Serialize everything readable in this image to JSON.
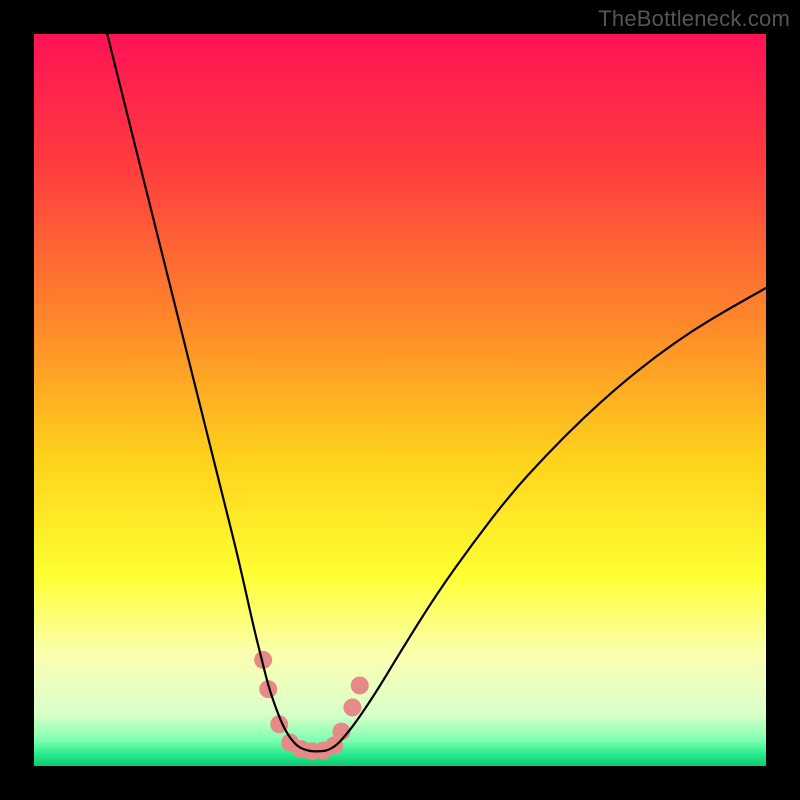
{
  "watermark": "TheBottleneck.com",
  "chart_data": {
    "type": "line",
    "title": "",
    "xlabel": "",
    "ylabel": "",
    "xlim": [
      0,
      100
    ],
    "ylim": [
      0,
      100
    ],
    "grid": false,
    "legend": false,
    "background_gradient_stops": [
      {
        "pos": 0.0,
        "color": "#ff1356"
      },
      {
        "pos": 0.18,
        "color": "#ff3c3e"
      },
      {
        "pos": 0.4,
        "color": "#ff8a2a"
      },
      {
        "pos": 0.58,
        "color": "#ffd21c"
      },
      {
        "pos": 0.74,
        "color": "#ffff33"
      },
      {
        "pos": 0.85,
        "color": "#faffb2"
      },
      {
        "pos": 0.93,
        "color": "#d9ffc9"
      },
      {
        "pos": 0.965,
        "color": "#7dffb0"
      },
      {
        "pos": 0.985,
        "color": "#25e98c"
      },
      {
        "pos": 1.0,
        "color": "#0dc973"
      }
    ],
    "series": [
      {
        "name": "bottleneck-curve",
        "color": "#000000",
        "stroke_width": 2.2,
        "x": [
          10,
          12,
          14,
          16,
          18,
          20,
          22,
          24,
          26,
          28,
          30,
          31,
          32,
          33,
          34,
          35,
          36,
          37,
          38,
          39,
          40,
          41,
          42,
          44,
          47,
          50,
          55,
          60,
          65,
          70,
          75,
          80,
          85,
          90,
          95,
          100
        ],
        "y": [
          100,
          92,
          84,
          76,
          68,
          60,
          52,
          44,
          36,
          28,
          19,
          15,
          11,
          8,
          5.5,
          3.8,
          2.7,
          2.2,
          2.0,
          2.0,
          2.1,
          2.6,
          3.5,
          6.0,
          10.5,
          15.5,
          23.5,
          30.5,
          37.0,
          42.5,
          47.5,
          52.0,
          56.0,
          59.5,
          62.5,
          65.3
        ]
      }
    ],
    "markers": {
      "name": "highlight-dots",
      "color": "#e58a86",
      "radius": 9,
      "points": [
        {
          "x": 31.3,
          "y": 14.5
        },
        {
          "x": 32.0,
          "y": 10.5
        },
        {
          "x": 33.5,
          "y": 5.7
        },
        {
          "x": 35.0,
          "y": 3.2
        },
        {
          "x": 36.5,
          "y": 2.3
        },
        {
          "x": 38.0,
          "y": 2.0
        },
        {
          "x": 39.5,
          "y": 2.1
        },
        {
          "x": 41.0,
          "y": 2.8
        },
        {
          "x": 42.0,
          "y": 4.7
        },
        {
          "x": 43.5,
          "y": 8.0
        },
        {
          "x": 44.5,
          "y": 11.0
        }
      ]
    }
  }
}
